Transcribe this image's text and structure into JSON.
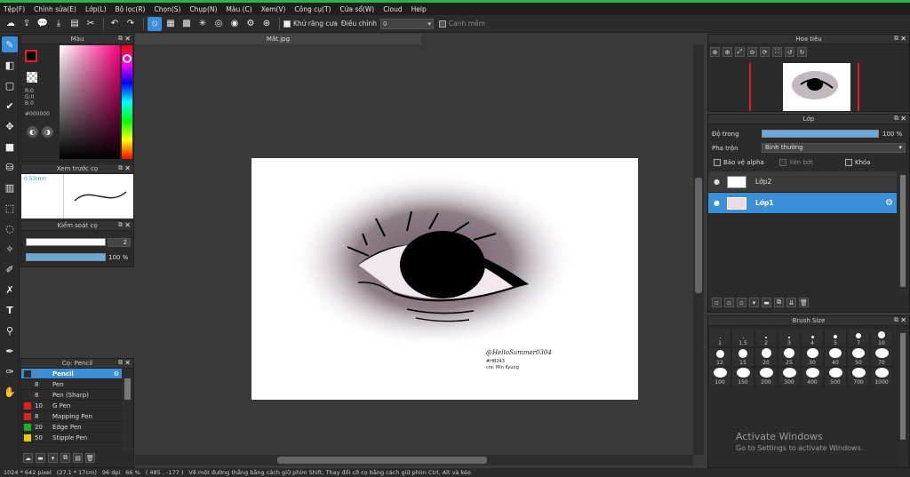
{
  "menu": [
    "Tệp(F)",
    "Chỉnh sửa(E)",
    "Lớp(L)",
    "Bộ lọc(R)",
    "Chọn(S)",
    "Chụp(N)",
    "Màu (C)",
    "Xem(V)",
    "Công cụ(T)",
    "Cửa sổ(W)",
    "Cloud",
    "Help"
  ],
  "toolbar": {
    "antialias_label": "Khử răng cưa",
    "adjust_label": "Điều chỉnh",
    "adjust_value": "0",
    "smooth_label": "Cạnh mềm"
  },
  "color_panel": {
    "title": "Màu",
    "r": "R:0",
    "g": "G:0",
    "b": "B:0",
    "hex": "#000000"
  },
  "preview_panel": {
    "title": "Xem trước cọ",
    "size": "0.53mm"
  },
  "brush_control": {
    "title": "Kiểm soát cọ",
    "size_value": "2",
    "opacity_value": "100 %"
  },
  "brush_list": {
    "title": "Cọ: Pencil",
    "items": [
      {
        "size": "2",
        "name": "Pencil",
        "color": "#2b2b2b",
        "selected": true
      },
      {
        "size": "8",
        "name": "Pen",
        "color": "#2b2b2b",
        "selected": false
      },
      {
        "size": "8",
        "name": "Pen (Sharp)",
        "color": "#2b2b2b",
        "selected": false
      },
      {
        "size": "10",
        "name": "G Pen",
        "color": "#e02020",
        "selected": false
      },
      {
        "size": "8",
        "name": "Mapping Pen",
        "color": "#e02020",
        "selected": false
      },
      {
        "size": "20",
        "name": "Edge Pen",
        "color": "#20b020",
        "selected": false
      },
      {
        "size": "50",
        "name": "Stipple Pen",
        "color": "#e0d000",
        "selected": false
      }
    ]
  },
  "document": {
    "tab": "Mắt.jpg",
    "signature": "@HelloSummer0304",
    "sig2": "#HB243",
    "sig3": "cre: Min Kyung"
  },
  "navigator": {
    "title": "Hoa tiêu"
  },
  "layer_panel": {
    "title": "Lớp",
    "opacity_label": "Độ trong",
    "opacity_value": "100 %",
    "blend_label": "Pha trộn",
    "blend_value": "Bình thường",
    "protect_alpha": "Bảo vệ alpha",
    "clipping": "Xén bớt",
    "lock": "Khóa",
    "layers": [
      {
        "name": "Lớp2",
        "selected": false
      },
      {
        "name": "Lớp1",
        "selected": true
      }
    ]
  },
  "brush_size": {
    "title": "Brush Size",
    "sizes": [
      "1",
      "1.5",
      "2",
      "3",
      "4",
      "5",
      "7",
      "10",
      "12",
      "15",
      "20",
      "25",
      "30",
      "40",
      "50",
      "70",
      "100",
      "150",
      "200",
      "300",
      "400",
      "500",
      "700",
      "1000"
    ]
  },
  "status": {
    "dims": "1024 * 642 pixel",
    "phys": "(27.1 * 17cm)",
    "dpi": "96 dpi",
    "zoom": "66 %",
    "coords": "( 485 , -177 )",
    "hint": "Vẽ một đường thẳng bằng cách giữ phím Shift, Thay đổi cỡ cọ bằng cách giữ phím Ctrl, Alt và kéo"
  },
  "activate": {
    "line1": "Activate Windows",
    "line2": "Go to Settings to activate Windows."
  }
}
